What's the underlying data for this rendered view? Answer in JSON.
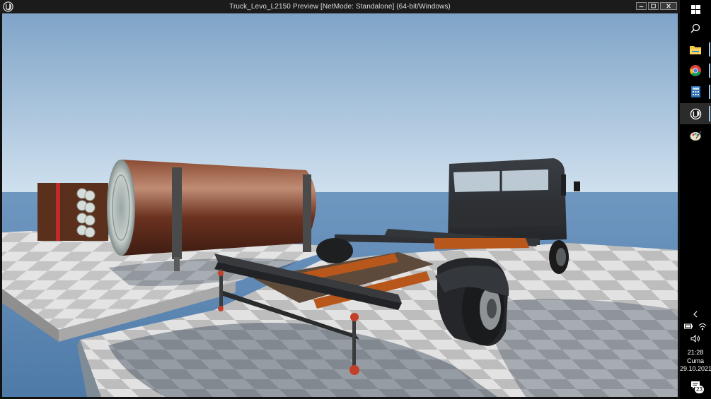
{
  "window": {
    "title": "Truck_Levo_L2150 Preview [NetMode: Standalone]  (64-bit/Windows)",
    "app_icon": "unreal-engine-icon"
  },
  "window_controls": [
    "minimize-icon",
    "maximize-icon",
    "close-icon"
  ],
  "taskbar": {
    "apps": [
      {
        "name": "windows-start",
        "icon": "windows-logo-icon"
      },
      {
        "name": "search",
        "icon": "search-icon"
      },
      {
        "name": "file-explorer",
        "icon": "folder-icon"
      },
      {
        "name": "chrome",
        "icon": "chrome-icon"
      },
      {
        "name": "calculator",
        "icon": "calculator-icon"
      },
      {
        "name": "unreal-engine",
        "icon": "unreal-engine-icon",
        "active": true
      },
      {
        "name": "paint",
        "icon": "paint-icon"
      }
    ],
    "tray": {
      "time": "21:28",
      "day": "Cuma",
      "date": "29.10.2021",
      "notification_count": "23"
    }
  },
  "colors": {
    "title_bar": "#1b1b1b",
    "taskbar": "#000000",
    "sky_top": "#7fa4c8",
    "sky_bottom": "#c9ddee",
    "water": "#5a86b4",
    "floor_light": "#e6e6e6",
    "floor_dark": "#bcbcbc",
    "rust": "#b5561c",
    "log": "#6b3220",
    "cab": "#2c2f33"
  }
}
